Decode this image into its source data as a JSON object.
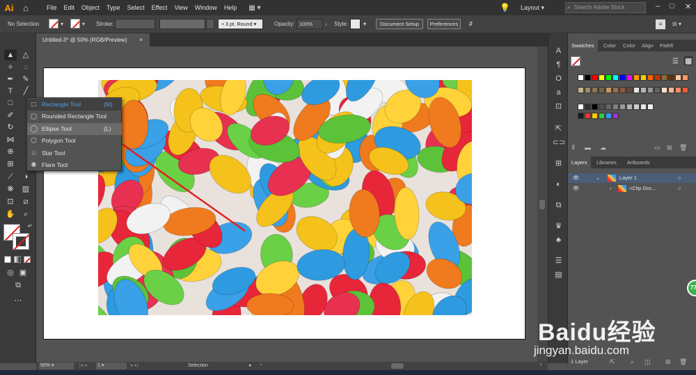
{
  "app": {
    "logo": "Ai",
    "home_icon": "home-icon"
  },
  "menu": {
    "items": [
      "File",
      "Edit",
      "Object",
      "Type",
      "Select",
      "Effect",
      "View",
      "Window",
      "Help"
    ],
    "layout_label": "Layout",
    "search_placeholder": "Search Adobe Stock"
  },
  "control_bar": {
    "selection_state": "No Selection",
    "stroke_label": "Stroke:",
    "brush_label": "3 pt. Round",
    "opacity_label": "Opacity:",
    "opacity_value": "100%",
    "style_label": "Style:",
    "document_setup": "Document Setup",
    "preferences": "Preferences"
  },
  "document": {
    "tab_title": "Untitled-3* @ 50% (RGB/Preview)",
    "close_glyph": "×"
  },
  "flyout": {
    "items": [
      {
        "label": "Rectangle Tool",
        "shortcut": "(M)"
      },
      {
        "label": "Rounded Rectangle Tool",
        "shortcut": ""
      },
      {
        "label": "Ellipse Tool",
        "shortcut": "(L)"
      },
      {
        "label": "Polygon Tool",
        "shortcut": ""
      },
      {
        "label": "Star Tool",
        "shortcut": ""
      },
      {
        "label": "Flare Tool",
        "shortcut": ""
      }
    ]
  },
  "status": {
    "zoom": "50%",
    "artboard_number": "1",
    "tool_status": "Selection"
  },
  "panels": {
    "swatches_tabs": [
      "Swatches",
      "Color",
      "Color",
      "Align",
      "Pathfi"
    ],
    "layers_tabs": [
      "Layers",
      "Libraries",
      "Artboards"
    ],
    "layers": [
      {
        "name": "Layer 1"
      },
      {
        "name": "<Clip Gro..."
      }
    ],
    "layer_count": "1 Layer"
  },
  "watermark": {
    "brand": "Baidu经验",
    "url": "jingyan.baidu.com",
    "badge": "77"
  },
  "colors": {
    "annotation_arrow": "#e02020",
    "selected_accent": "#4f9fe6",
    "brand_logo": "#ff9a00"
  }
}
